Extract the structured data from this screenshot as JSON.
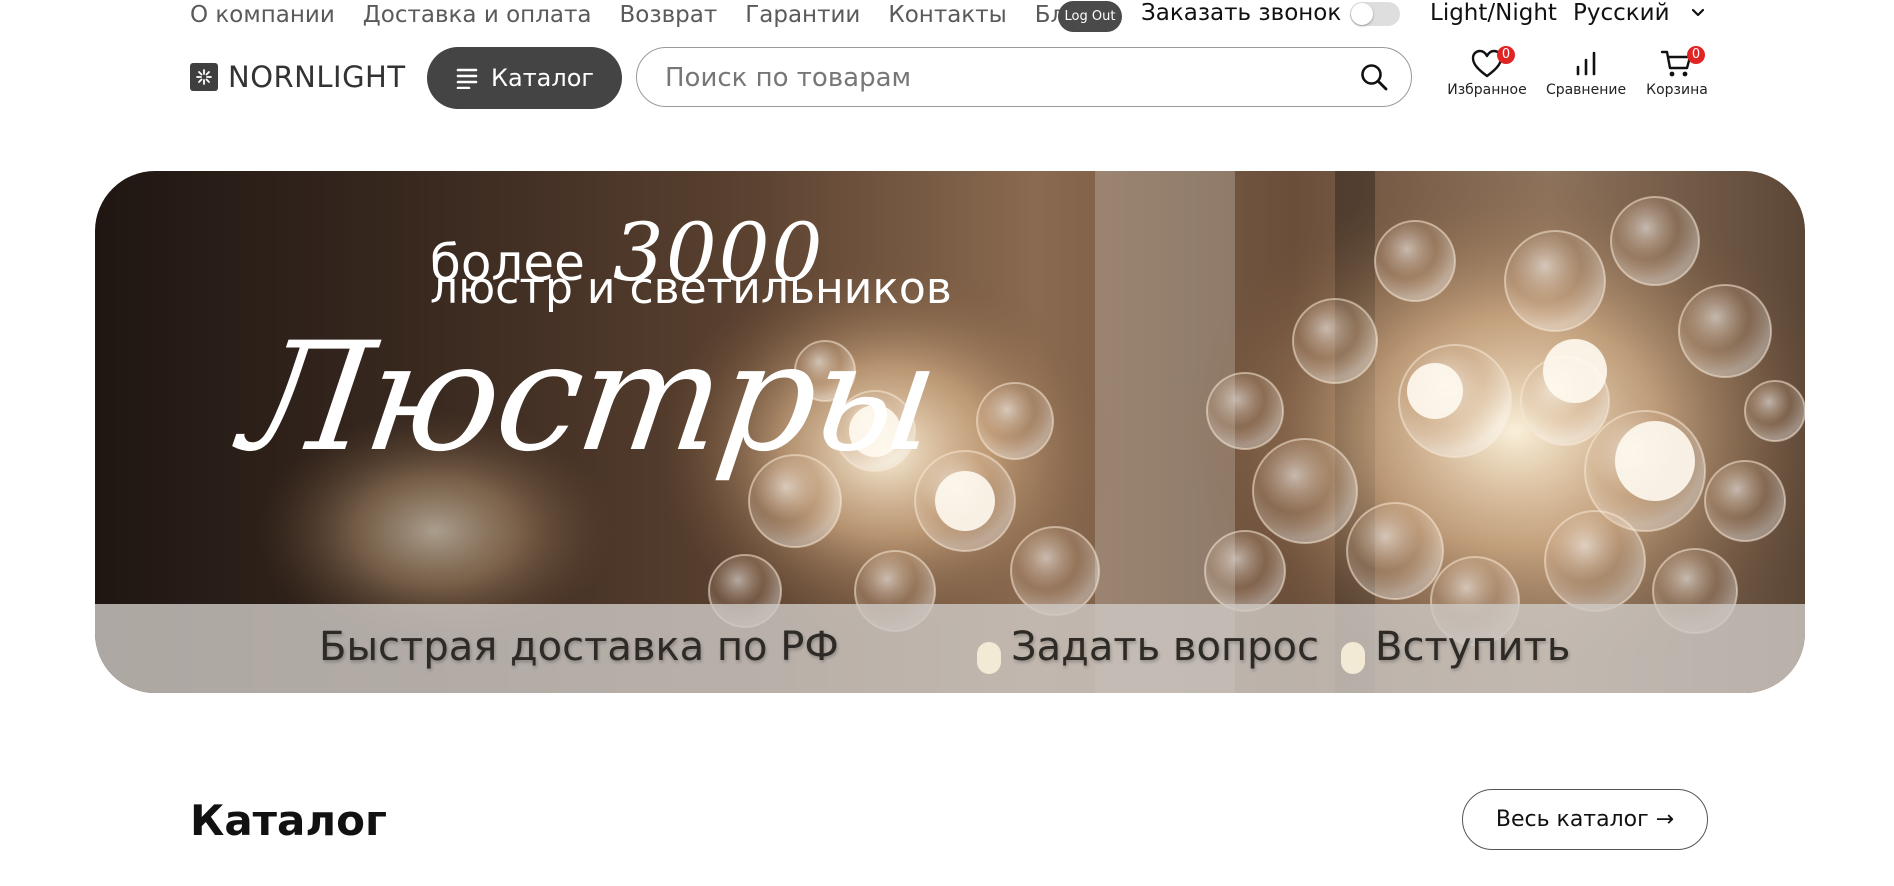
{
  "topnav": {
    "links": [
      "О компании",
      "Доставка и оплата",
      "Возврат",
      "Гарантии",
      "Контакты",
      "Блог"
    ],
    "logout_label": "Log Out",
    "callback_label": "Заказать звонок",
    "theme_label": "Light/Night",
    "language": "Русский"
  },
  "header": {
    "logo_text": "NORNLIGHT",
    "catalog_button": "Каталог",
    "search_placeholder": "Поиск по товарам",
    "favorites": {
      "label": "Избранное",
      "count": "0"
    },
    "compare": {
      "label": "Сравнение"
    },
    "cart": {
      "label": "Корзина",
      "count": "0"
    }
  },
  "banner": {
    "line1_small": "более",
    "line1_big": "3000",
    "line2": "люстр и светильников",
    "script_title": "Люстры",
    "strip": {
      "delivery": "Быстрая доставка по РФ",
      "ask": "Задать вопрос",
      "join": "Вступить"
    }
  },
  "catalog": {
    "title": "Каталог",
    "all_button": "Весь каталог →"
  },
  "colors": {
    "accent_dark": "#444444",
    "badge_red": "#e02424"
  }
}
